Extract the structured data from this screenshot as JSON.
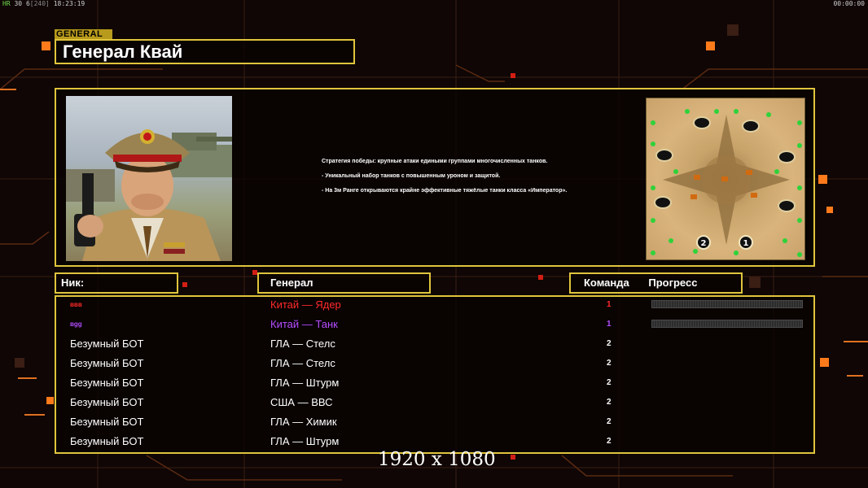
{
  "overlay": {
    "fps_label": "HR",
    "fps_value": "30",
    "fps_extra": "6",
    "fps_bracket": "[240]",
    "clock": "18:23:19",
    "timer": "00:00:00"
  },
  "general": {
    "tag": "GENERAL",
    "name": "Генерал Квай"
  },
  "description": [
    "Стратегия победы: крупные атаки едиными группами многочисленных танков.",
    "- Уникальный набор танков с повышенным уроном и защитой.",
    "- На 3м Ранге открываются крайне эффективные тяжёлые танки класса «Император»."
  ],
  "map": {
    "markers": [
      "2",
      "1"
    ]
  },
  "columns": {
    "nick": "Ник:",
    "general": "Генерал",
    "team": "Команда",
    "progress": "Прогресс"
  },
  "players": [
    {
      "nick": "ввв",
      "general": "Китай — Ядер",
      "team": "1",
      "color": "#ff2a2a",
      "progress": true
    },
    {
      "nick": "вgg",
      "general": "Китай — Танк",
      "team": "1",
      "color": "#b44dff",
      "progress": true
    },
    {
      "nick": "Безумный БОТ",
      "general": "ГЛА — Стелс",
      "team": "2",
      "color": "#ffffff",
      "progress": false
    },
    {
      "nick": "Безумный БОТ",
      "general": "ГЛА — Стелс",
      "team": "2",
      "color": "#ffffff",
      "progress": false
    },
    {
      "nick": "Безумный БОТ",
      "general": "ГЛА — Штурм",
      "team": "2",
      "color": "#ffffff",
      "progress": false
    },
    {
      "nick": "Безумный БОТ",
      "general": "США — ВВС",
      "team": "2",
      "color": "#ffffff",
      "progress": false
    },
    {
      "nick": "Безумный БОТ",
      "general": "ГЛА — Химик",
      "team": "2",
      "color": "#ffffff",
      "progress": false
    },
    {
      "nick": "Безумный БОТ",
      "general": "ГЛА — Штурм",
      "team": "2",
      "color": "#ffffff",
      "progress": false
    }
  ],
  "resolution": "1920 x 1080",
  "colors": {
    "accent": "#e0c43c",
    "background": "#0f0605",
    "orange": "#ff7a1a",
    "red_square": "#e02020"
  }
}
